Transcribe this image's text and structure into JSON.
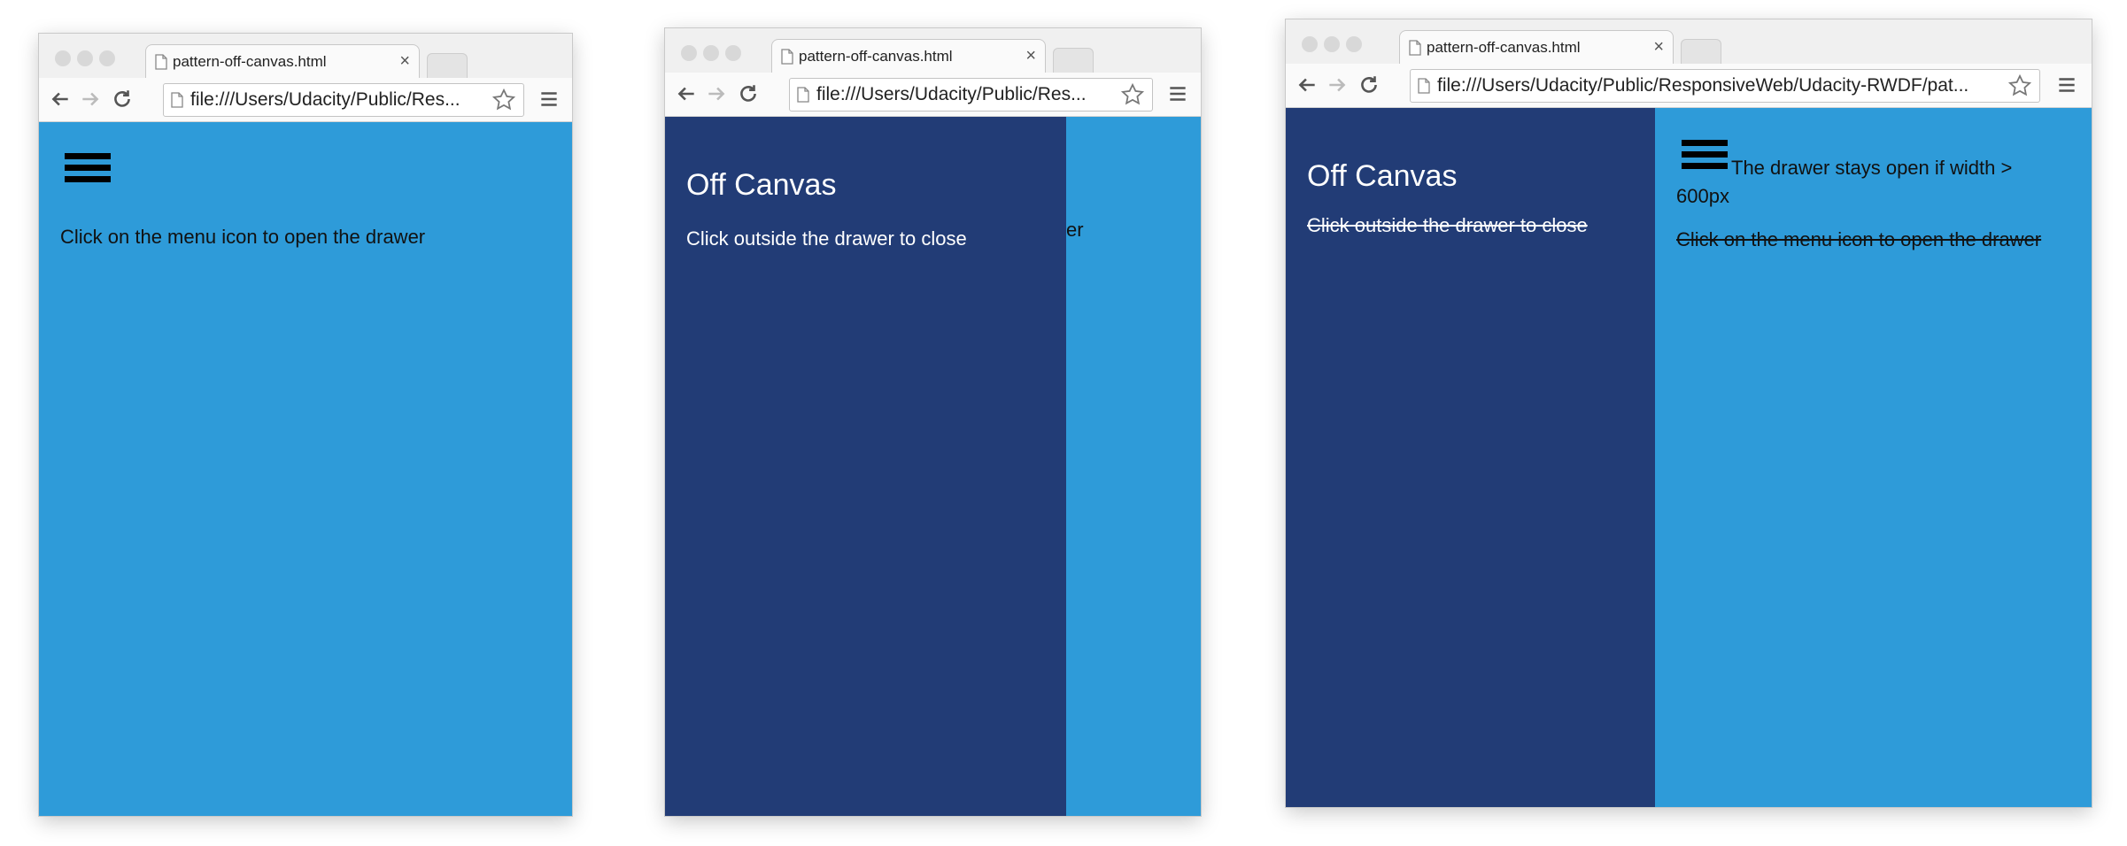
{
  "browser": {
    "tab_title": "pattern-off-canvas.html",
    "tab_close": "×",
    "url_short": "file:///Users/Udacity/Public/Res...",
    "url_long": "file:///Users/Udacity/Public/ResponsiveWeb/Udacity-RWDF/pat..."
  },
  "screens": {
    "closed": {
      "instruction": "Click on the menu icon to open the drawer"
    },
    "open": {
      "drawer_title": "Off Canvas",
      "drawer_instruction": "Click outside the drawer to close",
      "peek_text": "er"
    },
    "wide": {
      "drawer_title": "Off Canvas",
      "drawer_instruction": "Click outside the drawer to close",
      "note": "The drawer stays open if width > 600px",
      "instruction": "Click on the menu icon to open the drawer"
    }
  },
  "colors": {
    "content_bg": "#2e9bd9",
    "drawer_bg": "#223c76"
  }
}
